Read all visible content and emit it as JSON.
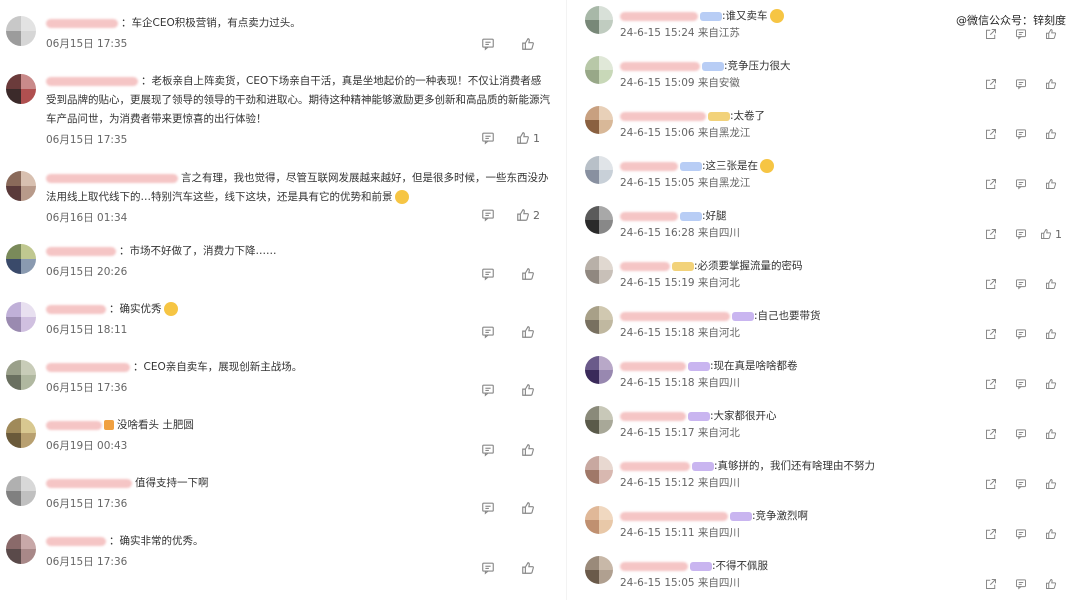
{
  "watermark": "@微信公众号：锌刻度",
  "left_comments": [
    {
      "text": "：车企CEO积极营销，有点卖力过头。",
      "time": "06月15日 17:35",
      "likes": "",
      "name_width": 72,
      "avatar": [
        "#c8c8c8",
        "#e3e3e3",
        "#9c9c9c",
        "#d6d6d6"
      ]
    },
    {
      "text": "：老板亲自上阵卖货，CEO下场亲自干活，真是坐地起价的一种表现！不仅让消费者感受到品牌的贴心，更展现了领导的领导的干劲和进取心。期待这种精神能够激励更多创新和高品质的新能源汽车产品问世，为消费者带来更惊喜的出行体验！",
      "time": "06月15日 17:35",
      "likes": "1",
      "name_width": 92,
      "avatar": [
        "#6b3b3b",
        "#c98a8a",
        "#3b2a2a",
        "#b05050"
      ]
    },
    {
      "text": "言之有理，我也觉得，尽管互联网发展越来越好，但是很多时候，一些东西没办法用线上取代线下的…特别汽车这些，线下这块，还是具有它的优势和前景",
      "time": "06月16日 01:34",
      "likes": "2",
      "name_width": 132,
      "emoji_end": true,
      "avatar": [
        "#8a6a5a",
        "#d8c0b0",
        "#5a3a3a",
        "#b89a8a"
      ]
    },
    {
      "text": "：市场不好做了，消费力下降……",
      "time": "06月15日 20:26",
      "likes": "",
      "name_width": 70,
      "avatar": [
        "#7a8a5a",
        "#c0c890",
        "#3a4a6a",
        "#8a9ab0"
      ]
    },
    {
      "text": "：确实优秀",
      "time": "06月15日 18:11",
      "likes": "",
      "name_width": 60,
      "emoji_end": true,
      "avatar": [
        "#c0b0d8",
        "#e8e0f0",
        "#9a8ab0",
        "#d0c0e0"
      ]
    },
    {
      "text": "：CEO亲自卖车，展现创新主战场。",
      "time": "06月15日 17:36",
      "likes": "",
      "name_width": 84,
      "avatar": [
        "#9aa08a",
        "#c8ccb8",
        "#6a7060",
        "#b0b8a0"
      ]
    },
    {
      "text": "没啥看头 土肥圆",
      "time": "06月19日 00:43",
      "likes": "",
      "name_width": 56,
      "crown": true,
      "avatar": [
        "#a08a5a",
        "#d8c890",
        "#6a5a3a",
        "#b8a070"
      ]
    },
    {
      "text": "值得支持一下啊",
      "time": "06月15日 17:36",
      "likes": "",
      "name_width": 86,
      "avatar": [
        "#b0b0b0",
        "#d8d8d8",
        "#808080",
        "#c0c0c0"
      ]
    },
    {
      "text": "：确实非常的优秀。",
      "time": "06月15日 17:36",
      "likes": "",
      "name_width": 60,
      "avatar": [
        "#8a6a6a",
        "#c8a8a8",
        "#5a4a4a",
        "#a88888"
      ]
    }
  ],
  "right_comments": [
    {
      "text": ":谁又卖车",
      "time": "24-6-15 15:24 来自江苏",
      "likes": "",
      "name_width": 78,
      "tag": "blue",
      "emoji_end": true,
      "avatar": [
        "#a8b8a8",
        "#d8e0d8",
        "#788878",
        "#c0ccc0"
      ]
    },
    {
      "text": ":竞争压力很大",
      "time": "24-6-15 15:09 来自安徽",
      "likes": "",
      "name_width": 80,
      "tag": "blue",
      "avatar": [
        "#b8c8a8",
        "#e0e8d8",
        "#98a888",
        "#c8d8b8"
      ]
    },
    {
      "text": ":太卷了",
      "time": "24-6-15 15:06 来自黑龙江",
      "likes": "",
      "name_width": 86,
      "tag": "gold",
      "avatar": [
        "#c8a080",
        "#e8d0b8",
        "#8a6040",
        "#d8b898"
      ]
    },
    {
      "text": ":这三张是在",
      "time": "24-6-15 15:05 来自黑龙江",
      "likes": "",
      "name_width": 58,
      "tag": "blue",
      "emoji_end": true,
      "avatar": [
        "#b8c0c8",
        "#e0e4e8",
        "#8890a0",
        "#c8d0d8"
      ]
    },
    {
      "text": ":好腿",
      "time": "24-6-15 16:28 来自四川",
      "likes": "1",
      "name_width": 58,
      "tag": "blue",
      "avatar": [
        "#5a5a5a",
        "#a8a8a8",
        "#2a2a2a",
        "#888888"
      ]
    },
    {
      "text": ":必须要掌握流量的密码",
      "time": "24-6-15 15:19 来自河北",
      "likes": "",
      "name_width": 50,
      "tag": "gold",
      "avatar": [
        "#b8b0a8",
        "#e0d8d0",
        "#908880",
        "#c8c0b8"
      ]
    },
    {
      "text": ":自己也要带货",
      "time": "24-6-15 15:18 来自河北",
      "likes": "",
      "name_width": 110,
      "tag": "purple",
      "avatar": [
        "#a8a088",
        "#d0c8b0",
        "#787060",
        "#c0b8a0"
      ]
    },
    {
      "text": ":现在真是啥啥都卷",
      "time": "24-6-15 15:18 来自四川",
      "likes": "",
      "name_width": 66,
      "tag": "purple",
      "avatar": [
        "#6a5a8a",
        "#b8a8c8",
        "#3a2a5a",
        "#9888b0"
      ]
    },
    {
      "text": ":大家都很开心",
      "time": "24-6-15 15:17 来自河北",
      "likes": "",
      "name_width": 66,
      "tag": "purple",
      "avatar": [
        "#8a8a7a",
        "#c8c8b8",
        "#5a5a4a",
        "#a8a898"
      ]
    },
    {
      "text": ":真够拼的，我们还有啥理由不努力",
      "time": "24-6-15 15:12 来自四川",
      "likes": "",
      "name_width": 70,
      "tag": "purple",
      "avatar": [
        "#c8a8a0",
        "#e8d8d0",
        "#a07868",
        "#d8b8b0"
      ]
    },
    {
      "text": ":竞争激烈啊",
      "time": "24-6-15 15:11 来自四川",
      "likes": "",
      "name_width": 108,
      "tag": "purple",
      "avatar": [
        "#e0b898",
        "#f0d8c0",
        "#c09070",
        "#e8c8a8"
      ]
    },
    {
      "text": ":不得不佩服",
      "time": "24-6-15 15:05 来自四川",
      "likes": "",
      "name_width": 68,
      "tag": "purple",
      "avatar": [
        "#9a8a7a",
        "#c8b8a8",
        "#6a5a4a",
        "#b0a090"
      ]
    }
  ]
}
